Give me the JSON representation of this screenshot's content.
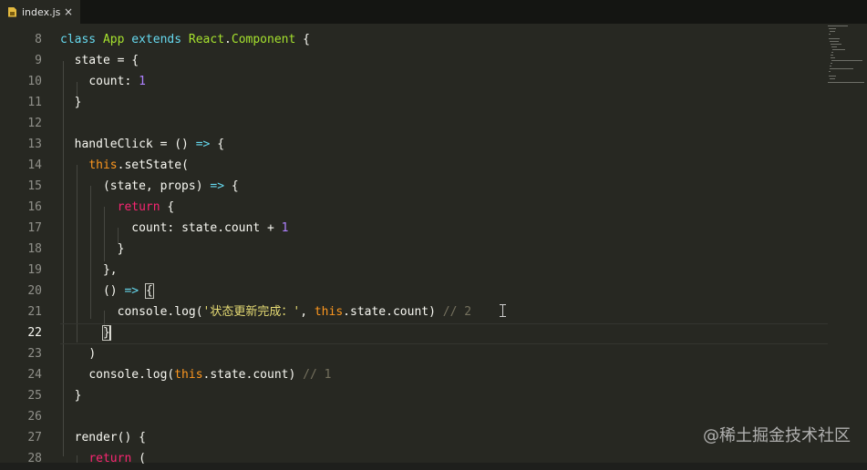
{
  "tab": {
    "filename": "index.js",
    "close": "×"
  },
  "lines": [
    {
      "num": "8",
      "tokens": [
        [
          "kw",
          "class"
        ],
        [
          "",
          ""
        ],
        [
          " ",
          ""
        ],
        [
          "cls",
          "App"
        ],
        [
          " ",
          ""
        ],
        [
          "kw",
          "extends"
        ],
        [
          " ",
          ""
        ],
        [
          "cls",
          "React"
        ],
        [
          "",
          "."
        ],
        [
          "cls",
          "Component"
        ],
        [
          "",
          " {"
        ]
      ]
    },
    {
      "num": "9"
    },
    {
      "num": "10"
    }
  ],
  "code": {
    "l8": {
      "n": "8",
      "class": "class",
      "app": "App",
      "extends": "extends",
      "react": "React",
      "dot": ".",
      "component": "Component",
      "brace": "{"
    },
    "l9": {
      "n": "9",
      "text1": "state",
      "text2": " = {"
    },
    "l10": {
      "n": "10",
      "key": "count:",
      "val": "1"
    },
    "l11": {
      "n": "11",
      "text": "}"
    },
    "l12": {
      "n": "12"
    },
    "l13": {
      "n": "13",
      "name": "handleClick",
      "eq": " = () ",
      "arrow": "=>",
      "brace": " {"
    },
    "l14": {
      "n": "14",
      "this": "this",
      "call": ".setState("
    },
    "l15": {
      "n": "15",
      "open": "(state, props) ",
      "arrow": "=>",
      "brace": " {"
    },
    "l16": {
      "n": "16",
      "ret": "return",
      "brace": " {"
    },
    "l17": {
      "n": "17",
      "key": "count: state.count + ",
      "val": "1"
    },
    "l18": {
      "n": "18",
      "text": "}"
    },
    "l19": {
      "n": "19",
      "text": "},"
    },
    "l20": {
      "n": "20",
      "open": "() ",
      "arrow": "=>",
      "brace": "{"
    },
    "l21": {
      "n": "21",
      "fn": "console.log(",
      "str": "'状态更新完成：'",
      "mid": ", ",
      "this": "this",
      "rest": ".state.count)",
      "cmt": "// 2"
    },
    "l22": {
      "n": "22",
      "brace": "}"
    },
    "l23": {
      "n": "23",
      "text": ")"
    },
    "l24": {
      "n": "24",
      "fn": "console.log(",
      "this": "this",
      "rest": ".state.count)",
      "cmt": "// 1"
    },
    "l25": {
      "n": "25",
      "text": "}"
    },
    "l26": {
      "n": "26"
    },
    "l27": {
      "n": "27",
      "text": "render() {"
    },
    "l28": {
      "n": "28",
      "ret": "return",
      "text": " ("
    }
  },
  "watermark": "@稀土掘金技术社区",
  "colors": {
    "background": "#272822",
    "keyword": "#66d9ef",
    "class": "#a6e22e",
    "number": "#ae81ff",
    "string": "#e6db74",
    "comment": "#75715e",
    "return": "#f92672",
    "this": "#fd971f"
  }
}
